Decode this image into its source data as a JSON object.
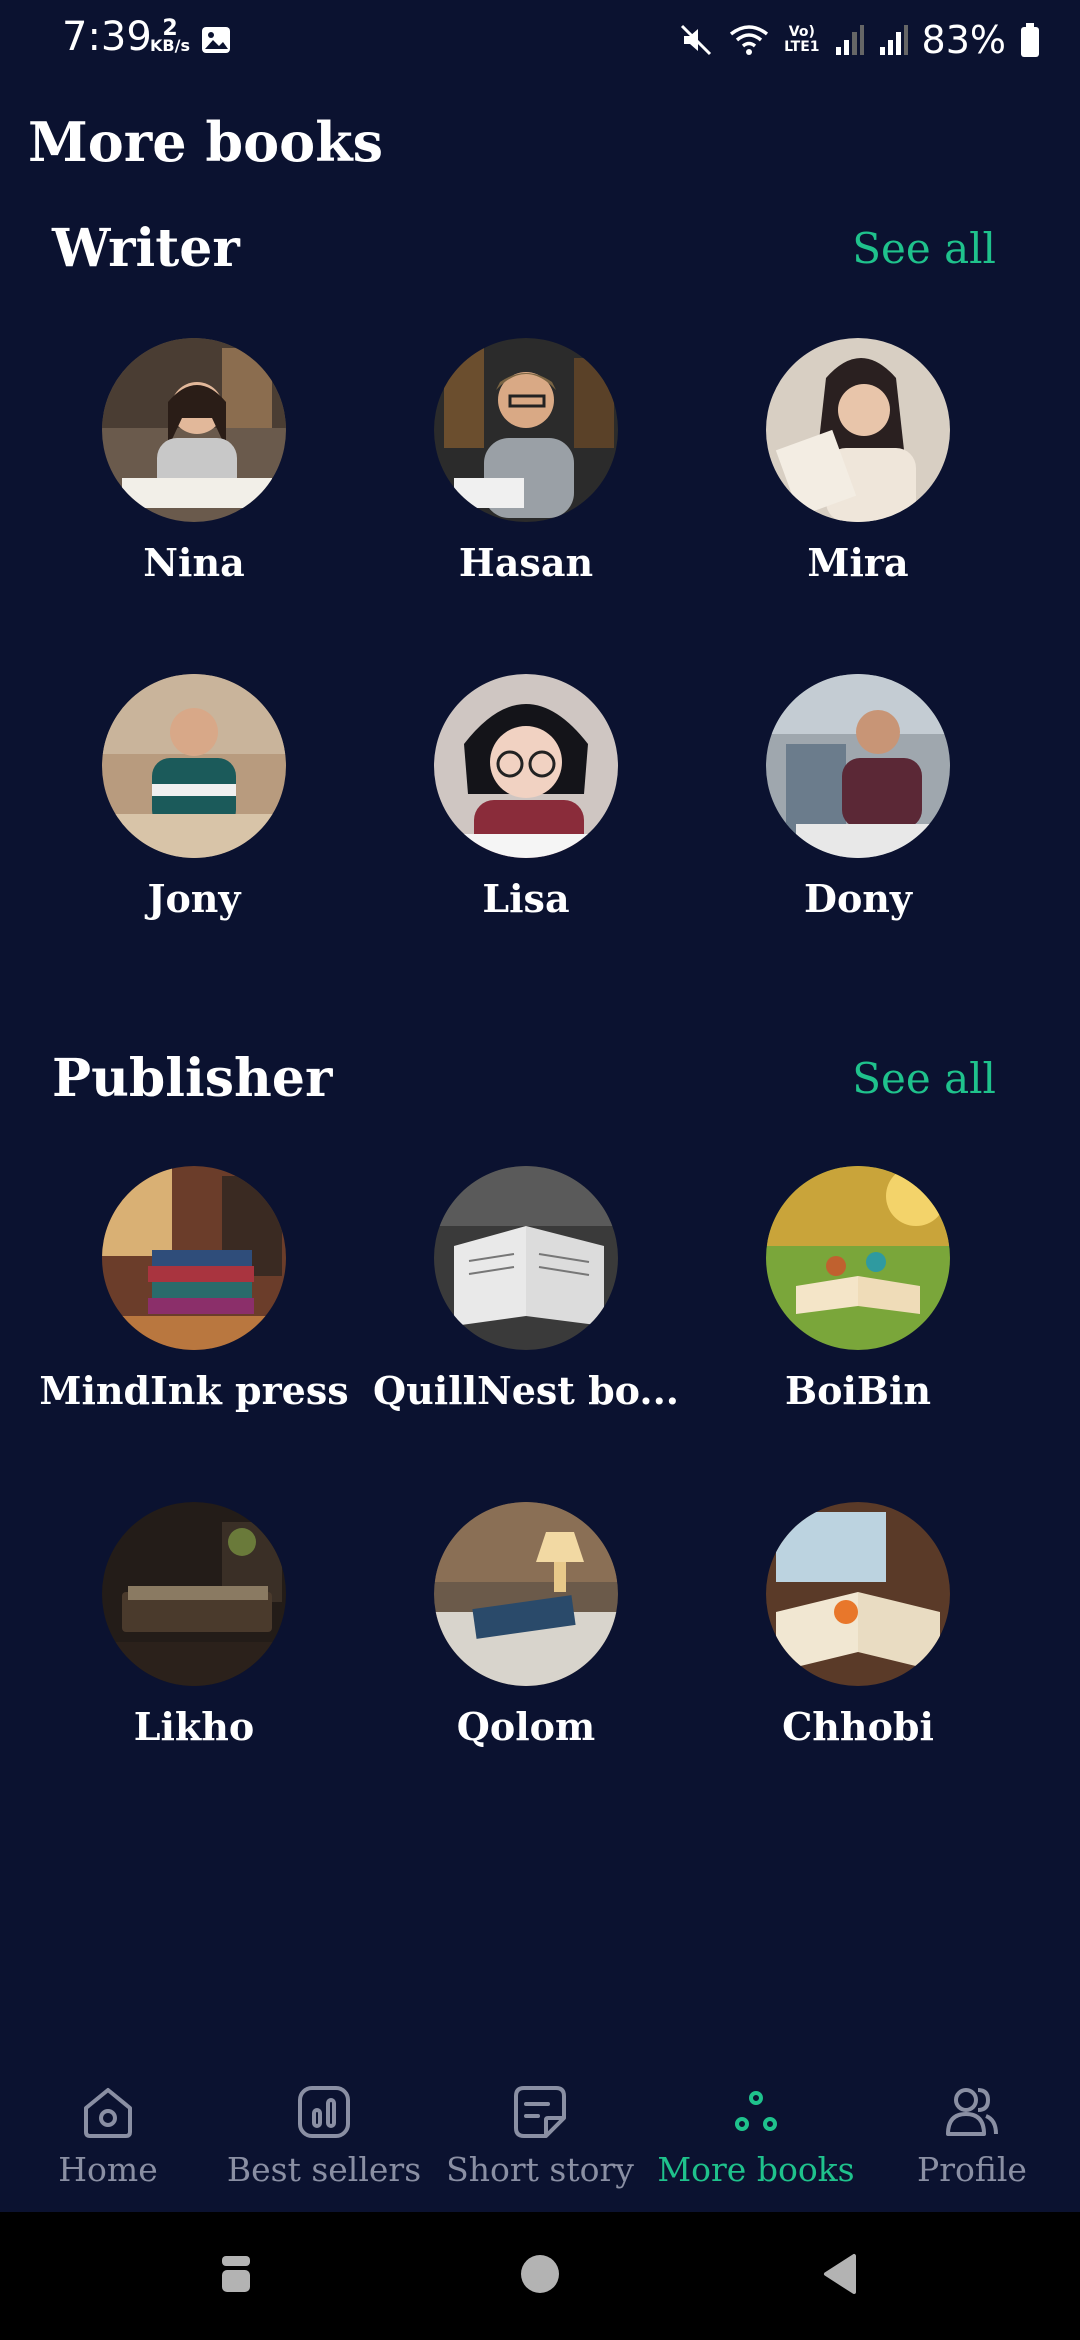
{
  "status_bar": {
    "time": "7:39",
    "net_speed_value": "2",
    "net_speed_unit": "KB/s",
    "volte": "Vo)",
    "lte": "LTE1",
    "battery": "83%"
  },
  "page": {
    "title": "More books"
  },
  "writer_section": {
    "title": "Writer",
    "see_all": "See all",
    "items": [
      {
        "name": "Nina"
      },
      {
        "name": "Hasan"
      },
      {
        "name": "Mira"
      },
      {
        "name": "Jony"
      },
      {
        "name": "Lisa"
      },
      {
        "name": "Dony"
      }
    ]
  },
  "publisher_section": {
    "title": "Publisher",
    "see_all": "See all",
    "items": [
      {
        "name": "MindInk press"
      },
      {
        "name": "QuillNest bo..."
      },
      {
        "name": "BoiBin"
      },
      {
        "name": "Likho"
      },
      {
        "name": "Qolom"
      },
      {
        "name": "Chhobi"
      }
    ]
  },
  "bottom_nav": {
    "items": [
      {
        "label": "Home",
        "icon": "home-icon"
      },
      {
        "label": "Best sellers",
        "icon": "chart-icon"
      },
      {
        "label": "Short story",
        "icon": "note-icon"
      },
      {
        "label": "More books",
        "icon": "dots-icon",
        "active": true
      },
      {
        "label": "Profile",
        "icon": "profile-icon"
      }
    ]
  },
  "colors": {
    "background": "#0b1230",
    "accent": "#1fc28c",
    "inactive": "#8a8fa3"
  }
}
